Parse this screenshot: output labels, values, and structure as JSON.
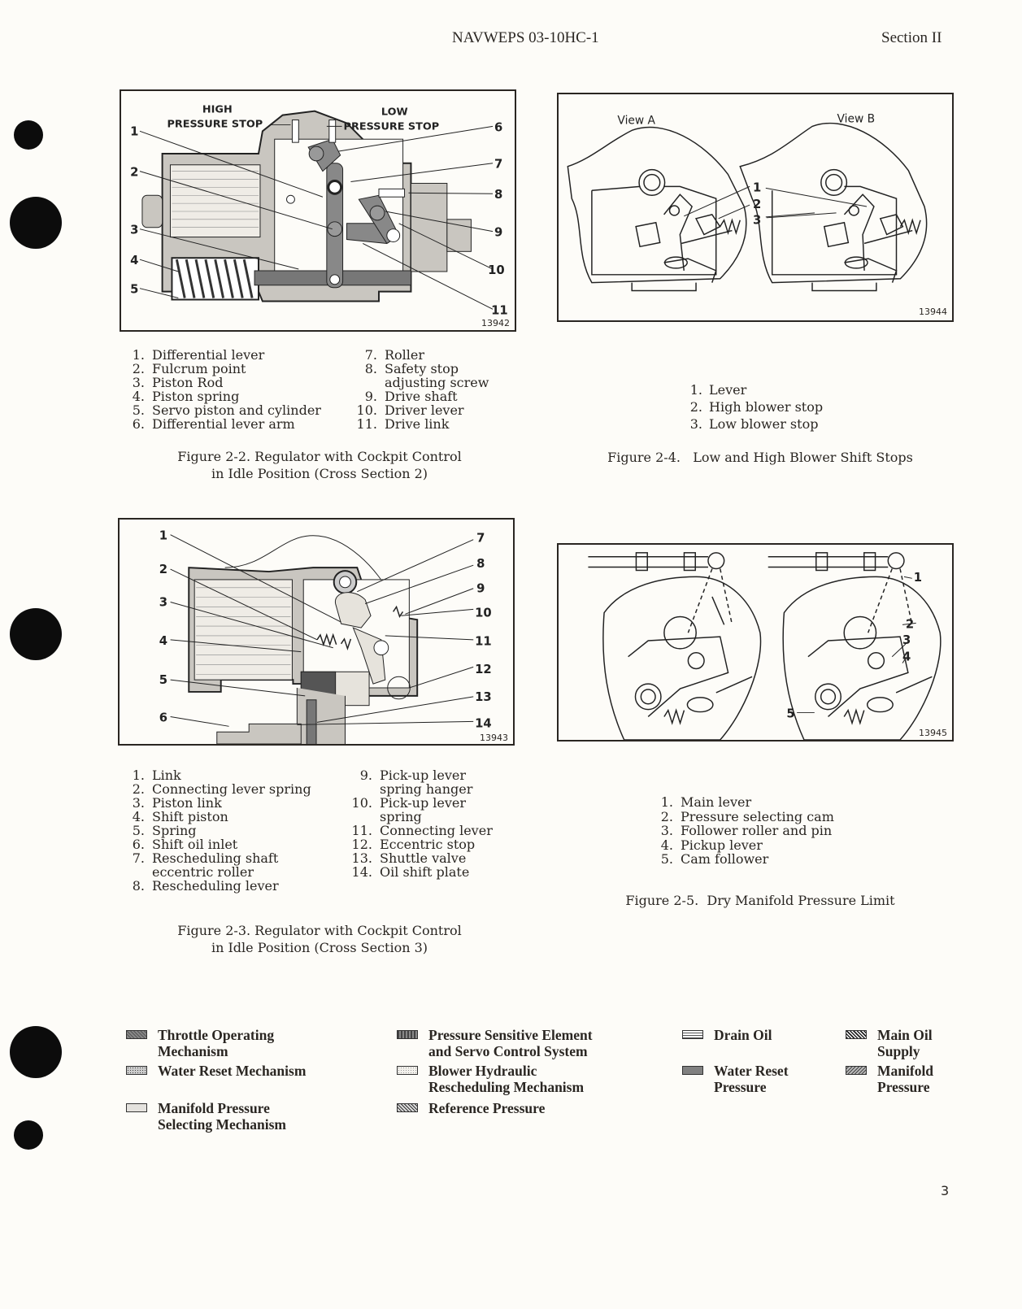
{
  "header": {
    "doc_number": "NAVWEPS 03-10HC-1",
    "section": "Section II"
  },
  "figures": {
    "fig_2_2": {
      "plate_number": "13942",
      "diagram_labels": {
        "high_stop": [
          "HIGH",
          "PRESSURE STOP"
        ],
        "low_stop": [
          "LOW",
          "PRESSURE STOP"
        ]
      },
      "callouts_left": [
        "1",
        "2",
        "3",
        "4",
        "5"
      ],
      "callouts_right": [
        "6",
        "7",
        "8",
        "9",
        "10",
        "11"
      ],
      "legend_col1": [
        {
          "num": "1.",
          "text": "Differential lever"
        },
        {
          "num": "2.",
          "text": "Fulcrum point"
        },
        {
          "num": "3.",
          "text": "Piston Rod"
        },
        {
          "num": "4.",
          "text": "Piston spring"
        },
        {
          "num": "5.",
          "text": "Servo piston and cylinder"
        },
        {
          "num": "6.",
          "text": "Differential lever arm"
        }
      ],
      "legend_col2": [
        {
          "num": "7.",
          "text": "Roller"
        },
        {
          "num": "8.",
          "text": "Safety stop"
        },
        {
          "num": "",
          "text": "adjusting screw"
        },
        {
          "num": "9.",
          "text": "Drive shaft"
        },
        {
          "num": "10.",
          "text": "Driver lever"
        },
        {
          "num": "11.",
          "text": "Drive link"
        }
      ],
      "caption": [
        "Figure 2-2.  Regulator with Cockpit Control",
        "in Idle Position (Cross Section 2)"
      ]
    },
    "fig_2_4": {
      "plate_number": "13944",
      "view_a": "View A",
      "view_b": "View B",
      "callouts": [
        "1",
        "2",
        "3"
      ],
      "legend": [
        {
          "num": "1.",
          "text": "Lever"
        },
        {
          "num": "2.",
          "text": "High blower stop"
        },
        {
          "num": "3.",
          "text": "Low blower stop"
        }
      ],
      "caption": "Figure 2-4.   Low and High Blower Shift Stops"
    },
    "fig_2_3": {
      "plate_number": "13943",
      "callouts_left": [
        "1",
        "2",
        "3",
        "4",
        "5",
        "6"
      ],
      "callouts_right": [
        "7",
        "8",
        "9",
        "10",
        "11",
        "12",
        "13",
        "14"
      ],
      "legend_col1": [
        {
          "num": "1.",
          "text": "Link"
        },
        {
          "num": "2.",
          "text": "Connecting lever spring"
        },
        {
          "num": "3.",
          "text": "Piston link"
        },
        {
          "num": "4.",
          "text": "Shift piston"
        },
        {
          "num": "5.",
          "text": "Spring"
        },
        {
          "num": "6.",
          "text": "Shift oil inlet"
        },
        {
          "num": "7.",
          "text": "Rescheduling shaft"
        },
        {
          "num": "",
          "text": "eccentric roller"
        },
        {
          "num": "8.",
          "text": "Rescheduling lever"
        }
      ],
      "legend_col2": [
        {
          "num": "9.",
          "text": "Pick-up lever"
        },
        {
          "num": "",
          "text": "spring hanger"
        },
        {
          "num": "10.",
          "text": "Pick-up lever"
        },
        {
          "num": "",
          "text": "spring"
        },
        {
          "num": "11.",
          "text": "Connecting lever"
        },
        {
          "num": "12.",
          "text": "Eccentric stop"
        },
        {
          "num": "13.",
          "text": "Shuttle valve"
        },
        {
          "num": "14.",
          "text": "Oil shift plate"
        }
      ],
      "caption": [
        "Figure 2-3.  Regulator with Cockpit Control",
        "in Idle Position (Cross Section 3)"
      ]
    },
    "fig_2_5": {
      "plate_number": "13945",
      "callouts": [
        "1",
        "2",
        "3",
        "4",
        "5"
      ],
      "legend": [
        {
          "num": "1.",
          "text": "Main lever"
        },
        {
          "num": "2.",
          "text": "Pressure selecting cam"
        },
        {
          "num": "3.",
          "text": "Follower roller and pin"
        },
        {
          "num": "4.",
          "text": "Pickup lever"
        },
        {
          "num": "5.",
          "text": "Cam follower"
        }
      ],
      "caption": "Figure 2-5.  Dry Manifold Pressure Limit"
    }
  },
  "shading_key": [
    {
      "pattern": "throttle",
      "lines": [
        "Throttle Operating",
        "Mechanism"
      ]
    },
    {
      "pattern": "water-mech",
      "lines": [
        "Water Reset Mechanism"
      ]
    },
    {
      "pattern": "manifold-sel",
      "lines": [
        "Manifold Pressure",
        "Selecting Mechanism"
      ]
    },
    {
      "pattern": "pressure",
      "lines": [
        "Pressure Sensitive Element",
        "and Servo Control System"
      ]
    },
    {
      "pattern": "blower",
      "lines": [
        "Blower Hydraulic",
        "Rescheduling Mechanism"
      ]
    },
    {
      "pattern": "reference",
      "lines": [
        "Reference Pressure"
      ]
    },
    {
      "pattern": "drain",
      "lines": [
        "Drain Oil"
      ]
    },
    {
      "pattern": "water-press",
      "lines": [
        "Water Reset",
        "Pressure"
      ]
    },
    {
      "pattern": "main-oil",
      "lines": [
        "Main Oil",
        "Supply"
      ]
    },
    {
      "pattern": "manifold-press",
      "lines": [
        "Manifold",
        "Pressure"
      ]
    }
  ],
  "page_number": "3"
}
